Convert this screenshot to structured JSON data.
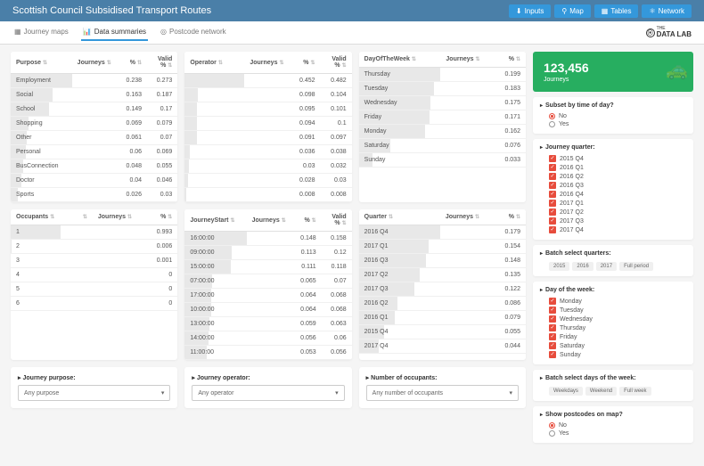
{
  "header": {
    "title": "Scottish Council Subsidised Transport Routes",
    "nav": [
      {
        "label": "Inputs",
        "icon": "⬇"
      },
      {
        "label": "Map",
        "icon": "⚲"
      },
      {
        "label": "Tables",
        "icon": "▦"
      },
      {
        "label": "Network",
        "icon": "⚛"
      }
    ]
  },
  "tabs": [
    {
      "label": "Journey maps",
      "icon": "▦",
      "active": false
    },
    {
      "label": "Data summaries",
      "icon": "📊",
      "active": true
    },
    {
      "label": "Postcode network",
      "icon": "◎",
      "active": false
    }
  ],
  "logo": {
    "text1": "THE",
    "text2": "DATA LAB",
    "mark": "⦿"
  },
  "tables": {
    "purpose": {
      "cols": [
        "Purpose",
        "Journeys",
        "%",
        "Valid %"
      ],
      "rows": [
        [
          "Employment",
          "",
          "0.238",
          "0.273"
        ],
        [
          "Social",
          "",
          "0.163",
          "0.187"
        ],
        [
          "School",
          "",
          "0.149",
          "0.17"
        ],
        [
          "Shopping",
          "",
          "0.069",
          "0.079"
        ],
        [
          "Other",
          "",
          "0.061",
          "0.07"
        ],
        [
          "Personal",
          "",
          "0.06",
          "0.069"
        ],
        [
          "BusConnection",
          "",
          "0.048",
          "0.055"
        ],
        [
          "Doctor",
          "",
          "0.04",
          "0.046"
        ],
        [
          "Sports",
          "",
          "0.026",
          "0.03"
        ]
      ],
      "bars": [
        1.0,
        0.68,
        0.63,
        0.29,
        0.26,
        0.25,
        0.2,
        0.17,
        0.11
      ]
    },
    "operator": {
      "cols": [
        "Operator",
        "Journeys",
        "%",
        "Valid %"
      ],
      "rows": [
        [
          "",
          "",
          "0.452",
          "0.482"
        ],
        [
          "",
          "",
          "0.098",
          "0.104"
        ],
        [
          "",
          "",
          "0.095",
          "0.101"
        ],
        [
          "",
          "",
          "0.094",
          "0.1"
        ],
        [
          "",
          "",
          "0.091",
          "0.097"
        ],
        [
          "",
          "",
          "0.036",
          "0.038"
        ],
        [
          "",
          "",
          "0.03",
          "0.032"
        ],
        [
          "",
          "",
          "0.028",
          "0.03"
        ],
        [
          "",
          "",
          "0.008",
          "0.008"
        ]
      ],
      "bars": [
        1.0,
        0.22,
        0.21,
        0.21,
        0.2,
        0.08,
        0.07,
        0.062,
        0.018
      ]
    },
    "day": {
      "cols": [
        "DayOfTheWeek",
        "Journeys",
        "%"
      ],
      "rows": [
        [
          "Thursday",
          "",
          "0.199"
        ],
        [
          "Tuesday",
          "",
          "0.183"
        ],
        [
          "Wednesday",
          "",
          "0.175"
        ],
        [
          "Friday",
          "",
          "0.171"
        ],
        [
          "Monday",
          "",
          "0.162"
        ],
        [
          "Saturday",
          "",
          "0.076"
        ],
        [
          "Sunday",
          "",
          "0.033"
        ]
      ],
      "bars": [
        1.0,
        0.92,
        0.88,
        0.86,
        0.81,
        0.38,
        0.17
      ]
    },
    "occupants": {
      "cols": [
        "Occupants",
        "",
        "Journeys",
        "%"
      ],
      "rows": [
        [
          "1",
          "",
          "",
          "0.993"
        ],
        [
          "2",
          "",
          "",
          "0.006"
        ],
        [
          "3",
          "",
          "",
          "0.001"
        ],
        [
          "4",
          "",
          "",
          "0"
        ],
        [
          "5",
          "",
          "",
          "0"
        ],
        [
          "6",
          "",
          "",
          "0"
        ]
      ],
      "bars": [
        1.0,
        0.006,
        0.001,
        0,
        0,
        0
      ]
    },
    "start": {
      "cols": [
        "JourneyStart",
        "Journeys",
        "%",
        "Valid %"
      ],
      "rows": [
        [
          "16:00:00",
          "",
          "0.148",
          "0.158"
        ],
        [
          "09:00:00",
          "",
          "0.113",
          "0.12"
        ],
        [
          "15:00:00",
          "",
          "0.111",
          "0.118"
        ],
        [
          "07:00:00",
          "",
          "0.065",
          "0.07"
        ],
        [
          "17:00:00",
          "",
          "0.064",
          "0.068"
        ],
        [
          "10:00:00",
          "",
          "0.064",
          "0.068"
        ],
        [
          "13:00:00",
          "",
          "0.059",
          "0.063"
        ],
        [
          "14:00:00",
          "",
          "0.056",
          "0.06"
        ],
        [
          "11:00:00",
          "",
          "0.053",
          "0.056"
        ]
      ],
      "bars": [
        1.0,
        0.76,
        0.75,
        0.44,
        0.43,
        0.43,
        0.4,
        0.38,
        0.36
      ]
    },
    "quarter": {
      "cols": [
        "Quarter",
        "Journeys",
        "%"
      ],
      "rows": [
        [
          "2016 Q4",
          "",
          "0.179"
        ],
        [
          "2017 Q1",
          "",
          "0.154"
        ],
        [
          "2016 Q3",
          "",
          "0.148"
        ],
        [
          "2017 Q2",
          "",
          "0.135"
        ],
        [
          "2017 Q3",
          "",
          "0.122"
        ],
        [
          "2016 Q2",
          "",
          "0.086"
        ],
        [
          "2016 Q1",
          "",
          "0.079"
        ],
        [
          "2015 Q4",
          "",
          "0.055"
        ],
        [
          "2017 Q4",
          "",
          "0.044"
        ]
      ],
      "bars": [
        1.0,
        0.86,
        0.83,
        0.75,
        0.68,
        0.48,
        0.44,
        0.31,
        0.25
      ]
    }
  },
  "selects": [
    {
      "label": "Journey purpose:",
      "value": "Any purpose"
    },
    {
      "label": "Journey operator:",
      "value": "Any operator"
    },
    {
      "label": "Number of occupants:",
      "value": "Any number of occupants"
    }
  ],
  "stat": {
    "value": "123,456",
    "label": "Journeys",
    "icon": "🚕"
  },
  "panels": {
    "subset": {
      "title": "Subset by time of day?",
      "options": [
        "No",
        "Yes"
      ],
      "selected": "No"
    },
    "jq": {
      "title": "Journey quarter:",
      "items": [
        "2015 Q4",
        "2016 Q1",
        "2016 Q2",
        "2016 Q3",
        "2016 Q4",
        "2017 Q1",
        "2017 Q2",
        "2017 Q3",
        "2017 Q4"
      ]
    },
    "bsq": {
      "title": "Batch select quarters:",
      "pills": [
        "2015",
        "2016",
        "2017",
        "Full period"
      ]
    },
    "dow": {
      "title": "Day of the week:",
      "items": [
        "Monday",
        "Tuesday",
        "Wednesday",
        "Thursday",
        "Friday",
        "Saturday",
        "Sunday"
      ]
    },
    "bsd": {
      "title": "Batch select days of the week:",
      "pills": [
        "Weekdays",
        "Weekend",
        "Full week"
      ]
    },
    "post": {
      "title": "Show postcodes on map?",
      "options": [
        "No",
        "Yes"
      ],
      "selected": "No"
    }
  }
}
